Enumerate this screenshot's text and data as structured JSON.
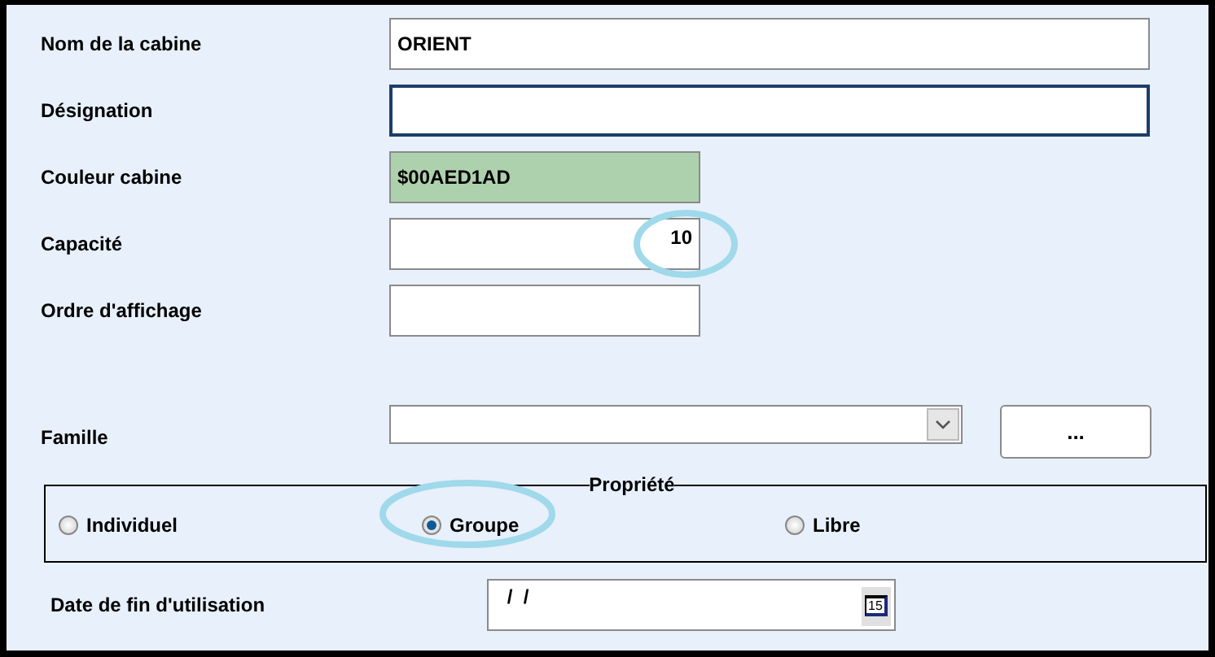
{
  "fields": [
    {
      "label": "Nom de la cabine",
      "value": "ORIENT",
      "kind": "wide",
      "focused": false
    },
    {
      "label": "Désignation",
      "kind": "wide",
      "focused": true
    },
    {
      "label": "Couleur cabine",
      "value": "$00AED1AD",
      "kind": "color",
      "color": "#aed1ad",
      "focused": false
    },
    {
      "label": "Capacité",
      "value": "10",
      "kind": "number",
      "focused": false,
      "highlighted": true
    },
    {
      "label": "Ordre d'affichage",
      "kind": "number",
      "focused": false
    }
  ],
  "famille": {
    "label": "Famille",
    "button": "..."
  },
  "propriete": {
    "legend": "Propriété",
    "options": [
      {
        "label": "Individuel",
        "selected": false
      },
      {
        "label": "Groupe",
        "selected": true,
        "highlighted": true
      },
      {
        "label": "Libre",
        "selected": false
      }
    ]
  },
  "date": {
    "label": "Date de fin d'utilisation",
    "value": " /  /",
    "calendar_day": "15"
  }
}
